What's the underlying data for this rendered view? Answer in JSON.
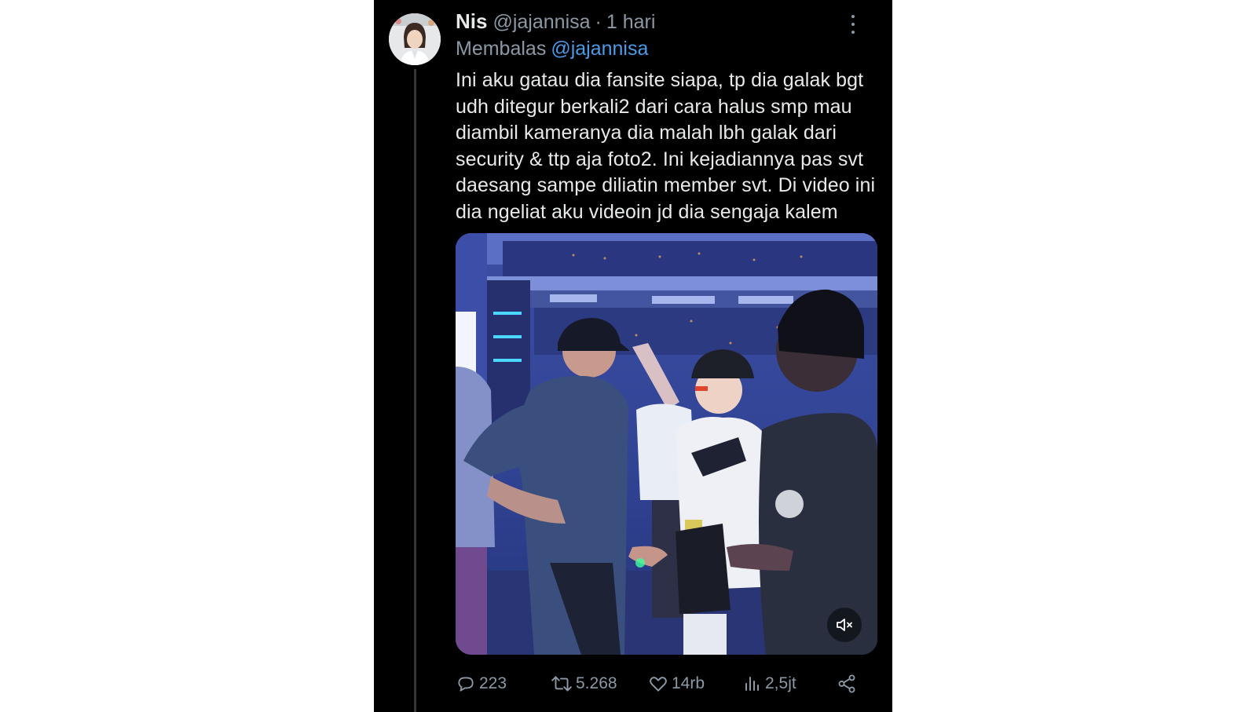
{
  "post": {
    "display_name": "Nis",
    "handle": "@jajannisa",
    "separator": "·",
    "time": "1 hari",
    "reply_label": "Membalas",
    "reply_to": "@jajannisa",
    "text": "Ini aku gatau dia fansite siapa, tp dia galak bgt udh ditegur berkali2 dari cara halus smp mau diambil kameranya dia malah lbh galak dari security & ttp aja foto2. Ini kejadiannya pas svt daesang sampe diliatin member svt. Di video ini dia ngeliat aku videoin jd dia sengaja kalem"
  },
  "media": {
    "type": "video",
    "muted": true,
    "mute_icon": "speaker-muted-icon"
  },
  "actions": {
    "replies": "223",
    "reposts": "5.268",
    "likes": "14rb",
    "views": "2,5jt"
  },
  "icons": {
    "more": "more-vertical-icon",
    "reply": "reply-icon",
    "repost": "repost-icon",
    "like": "heart-icon",
    "views": "views-icon",
    "share": "share-icon"
  },
  "colors": {
    "background": "#000000",
    "text": "#e7e9ea",
    "secondary": "#8b98a5",
    "link": "#4a9be8"
  }
}
